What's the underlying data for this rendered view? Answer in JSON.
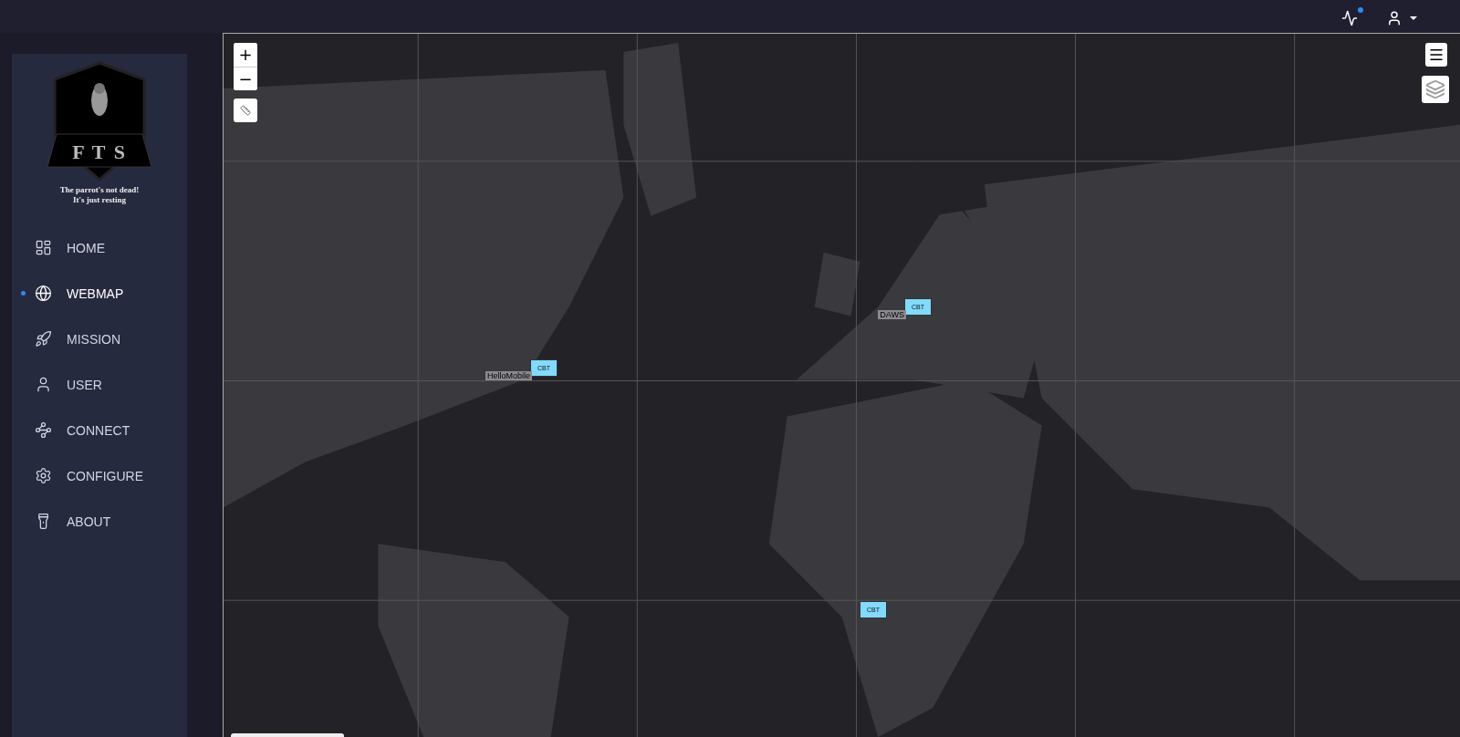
{
  "sidebar": {
    "logo": {
      "letters": "F T S",
      "tagline_1": "The parrot's not dead!",
      "tagline_2": "It's just resting"
    },
    "items": [
      {
        "label": "HOME",
        "selected": false
      },
      {
        "label": "WEBMAP",
        "selected": true
      },
      {
        "label": "MISSION",
        "selected": false
      },
      {
        "label": "USER",
        "selected": false
      },
      {
        "label": "CONNECT",
        "selected": false
      },
      {
        "label": "CONFIGURE",
        "selected": false
      },
      {
        "label": "ABOUT",
        "selected": false
      }
    ]
  },
  "topbar": {
    "activity_unread": true
  },
  "map": {
    "kind": "picture",
    "zoom_in": "+",
    "zoom_out": "−",
    "markers": [
      {
        "badge": "CBT",
        "label": "HelloMobile"
      },
      {
        "badge": "CBT",
        "label": "DAWS"
      },
      {
        "badge": "CBT"
      }
    ]
  }
}
